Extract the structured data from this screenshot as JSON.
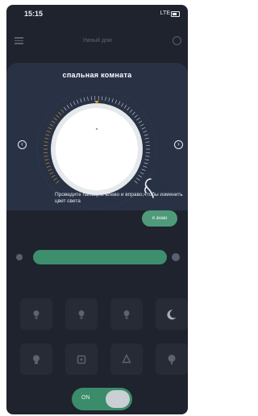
{
  "status": {
    "time": "15:15",
    "network": "LTE"
  },
  "appbar": {
    "title": "Умный дом"
  },
  "overlay": {
    "title": "спальная комната",
    "hint": "Проведите пальцем влево и вправо,чтобы изменить цвет света",
    "dial": {
      "level": 0.5
    }
  },
  "know_button": "я знаю",
  "brightness": {
    "level": 0.9
  },
  "tiles": [
    {
      "icon": "lamp-icon"
    },
    {
      "icon": "lamp-icon"
    },
    {
      "icon": "lamp-icon"
    },
    {
      "icon": "moon-icon"
    },
    {
      "icon": "bulb-icon"
    },
    {
      "icon": "square-icon"
    },
    {
      "icon": "leaf-icon"
    },
    {
      "icon": "bulb-icon"
    }
  ],
  "toggle": {
    "label": "ON"
  },
  "colors": {
    "accent": "#3b8c6b",
    "overlay": "#293245",
    "background": "#1f232d",
    "tick_warm": "#d79a3a"
  }
}
